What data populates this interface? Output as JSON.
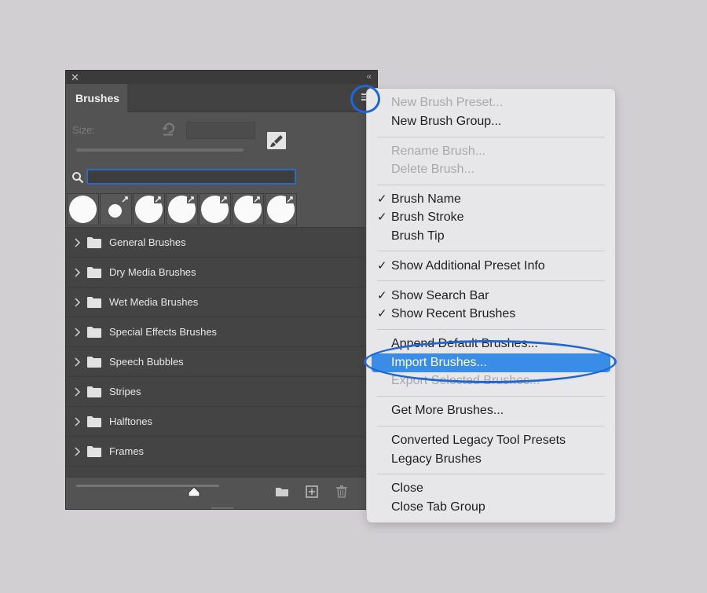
{
  "panel": {
    "tab_title": "Brushes",
    "size_label": "Size:",
    "search": {
      "value": "",
      "placeholder": ""
    },
    "groups": [
      {
        "label": "General Brushes"
      },
      {
        "label": "Dry Media Brushes"
      },
      {
        "label": "Wet Media Brushes"
      },
      {
        "label": "Special Effects Brushes"
      },
      {
        "label": "Speech Bubbles"
      },
      {
        "label": "Stripes"
      },
      {
        "label": "Halftones"
      },
      {
        "label": "Frames"
      }
    ]
  },
  "menu": {
    "items": [
      {
        "label": "New Brush Preset...",
        "enabled": false,
        "checked": false
      },
      {
        "label": "New Brush Group...",
        "enabled": true,
        "checked": false
      },
      {
        "label": "Rename Brush...",
        "enabled": false,
        "checked": false
      },
      {
        "label": "Delete Brush...",
        "enabled": false,
        "checked": false
      },
      {
        "label": "Brush Name",
        "enabled": true,
        "checked": true
      },
      {
        "label": "Brush Stroke",
        "enabled": true,
        "checked": true
      },
      {
        "label": "Brush Tip",
        "enabled": true,
        "checked": false
      },
      {
        "label": "Show Additional Preset Info",
        "enabled": true,
        "checked": true
      },
      {
        "label": "Show Search Bar",
        "enabled": true,
        "checked": true
      },
      {
        "label": "Show Recent Brushes",
        "enabled": true,
        "checked": true
      },
      {
        "label": "Append Default Brushes...",
        "enabled": true,
        "checked": false
      },
      {
        "label": "Import Brushes...",
        "enabled": true,
        "checked": false,
        "highlighted": true
      },
      {
        "label": "Export Selected Brushes...",
        "enabled": false,
        "checked": false
      },
      {
        "label": "Get More Brushes...",
        "enabled": true,
        "checked": false
      },
      {
        "label": "Converted Legacy Tool Presets",
        "enabled": true,
        "checked": false
      },
      {
        "label": "Legacy Brushes",
        "enabled": true,
        "checked": false
      },
      {
        "label": "Close",
        "enabled": true,
        "checked": false
      },
      {
        "label": "Close Tab Group",
        "enabled": true,
        "checked": false
      }
    ],
    "check_glyph": "✓"
  },
  "colors": {
    "highlight": "#3a8de7",
    "annotation": "#1f66d6",
    "panel_bg": "#535353",
    "menu_bg": "#e7e6e8"
  }
}
